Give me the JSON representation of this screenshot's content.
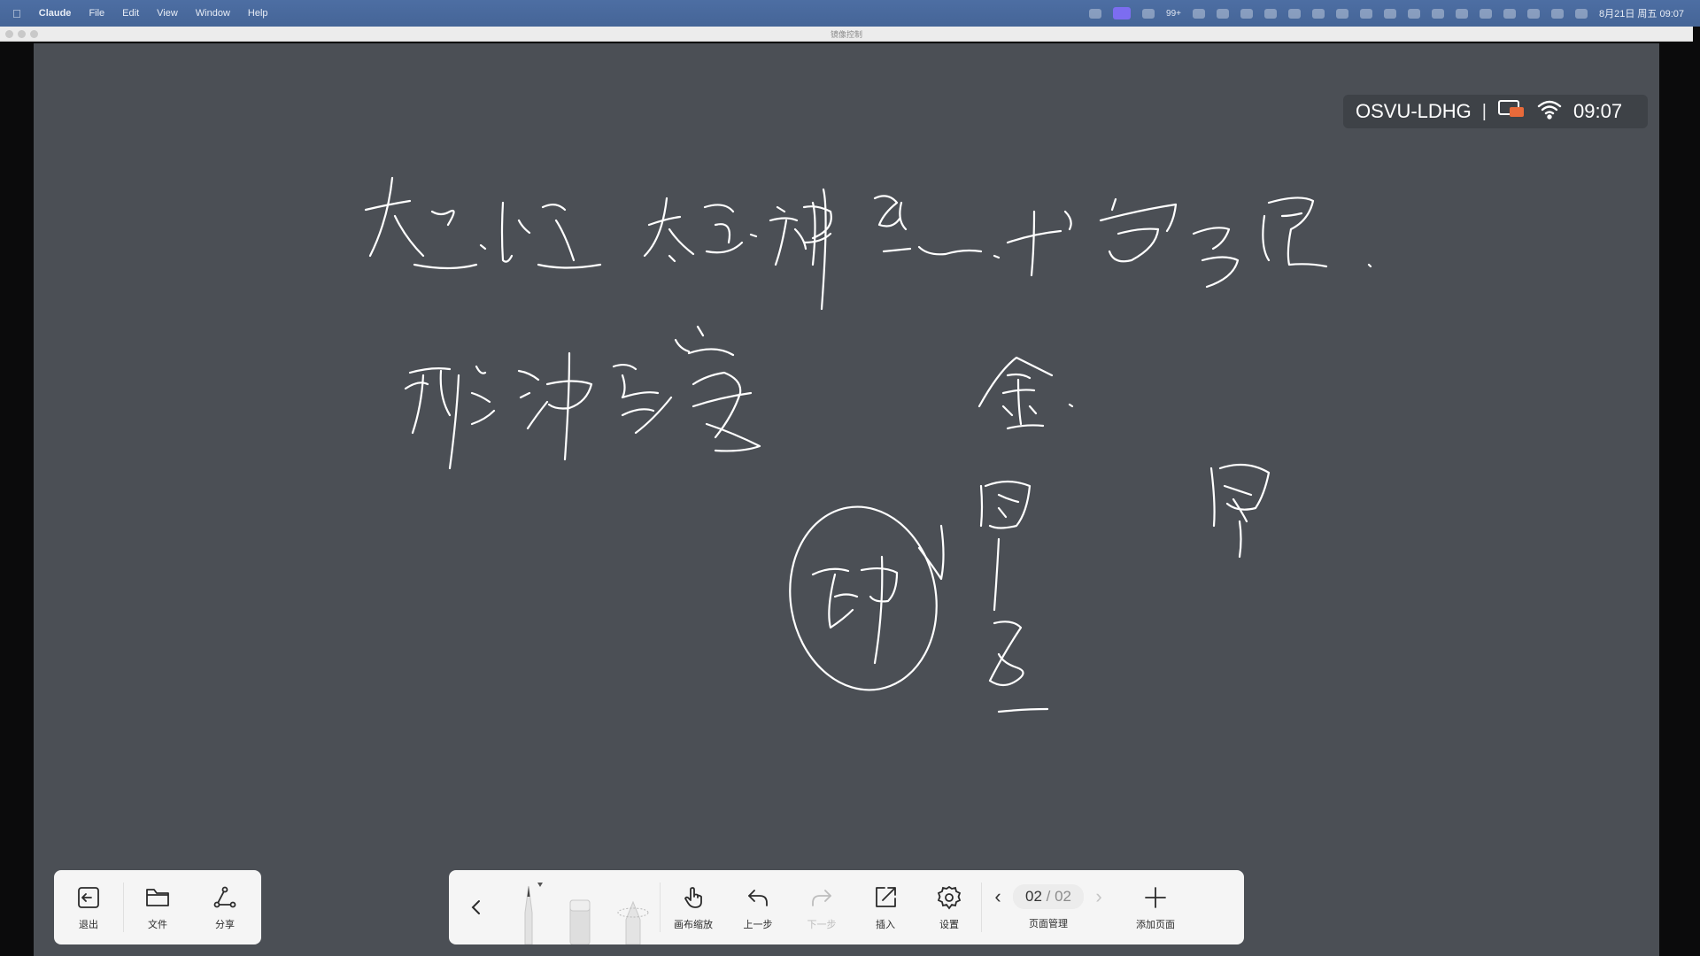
{
  "menubar": {
    "app_name": "Claude",
    "menus": [
      "File",
      "Edit",
      "View",
      "Window",
      "Help"
    ],
    "tray_badge": "99+",
    "datetime": "8月21日 周五 09:07"
  },
  "window": {
    "title": "镜像控制"
  },
  "status": {
    "device_code": "OSVU-LDHG",
    "separator": "|",
    "time": "09:07"
  },
  "left_toolbar": {
    "exit_label": "退出",
    "file_label": "文件",
    "share_label": "分享"
  },
  "main_toolbar": {
    "zoom_label": "画布缩放",
    "undo_label": "上一步",
    "redo_label": "下一步",
    "insert_label": "插入",
    "settings_label": "设置",
    "page_current": "02",
    "page_total": "/ 02",
    "page_manage_label": "页面管理",
    "add_page_label": "添加页面"
  },
  "colors": {
    "board": "#4b4f55",
    "ink": "#ffffff",
    "toolbar": "#f5f5f5",
    "menubar": "#4d6ea3"
  }
}
